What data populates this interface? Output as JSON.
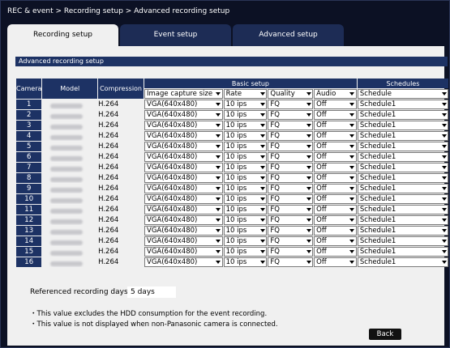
{
  "breadcrumb": "REC & event > Recording setup > Advanced recording setup",
  "tabs": [
    {
      "label": "Recording setup",
      "active": true
    },
    {
      "label": "Event setup",
      "active": false
    },
    {
      "label": "Advanced setup",
      "active": false
    }
  ],
  "section_title": "Advanced recording setup",
  "headers": {
    "camera": "Camera",
    "model": "Model",
    "compression": "Compression",
    "basic_setup": "Basic setup",
    "schedules": "Schedules",
    "image_capture_size": "Image capture size",
    "rate": "Rate",
    "quality": "Quality",
    "audio": "Audio",
    "schedule": "Schedule"
  },
  "rows": [
    {
      "camera": "1",
      "compression": "H.264",
      "size": "VGA(640x480)",
      "rate": "10 ips",
      "quality": "FQ",
      "audio": "Off",
      "schedule": "Schedule1"
    },
    {
      "camera": "2",
      "compression": "H.264",
      "size": "VGA(640x480)",
      "rate": "10 ips",
      "quality": "FQ",
      "audio": "Off",
      "schedule": "Schedule1"
    },
    {
      "camera": "3",
      "compression": "H.264",
      "size": "VGA(640x480)",
      "rate": "10 ips",
      "quality": "FQ",
      "audio": "Off",
      "schedule": "Schedule1"
    },
    {
      "camera": "4",
      "compression": "H.264",
      "size": "VGA(640x480)",
      "rate": "10 ips",
      "quality": "FQ",
      "audio": "Off",
      "schedule": "Schedule1"
    },
    {
      "camera": "5",
      "compression": "H.264",
      "size": "VGA(640x480)",
      "rate": "10 ips",
      "quality": "FQ",
      "audio": "Off",
      "schedule": "Schedule1"
    },
    {
      "camera": "6",
      "compression": "H.264",
      "size": "VGA(640x480)",
      "rate": "10 ips",
      "quality": "FQ",
      "audio": "Off",
      "schedule": "Schedule1"
    },
    {
      "camera": "7",
      "compression": "H.264",
      "size": "VGA(640x480)",
      "rate": "10 ips",
      "quality": "FQ",
      "audio": "Off",
      "schedule": "Schedule1"
    },
    {
      "camera": "8",
      "compression": "H.264",
      "size": "VGA(640x480)",
      "rate": "10 ips",
      "quality": "FQ",
      "audio": "Off",
      "schedule": "Schedule1"
    },
    {
      "camera": "9",
      "compression": "H.264",
      "size": "VGA(640x480)",
      "rate": "10 ips",
      "quality": "FQ",
      "audio": "Off",
      "schedule": "Schedule1"
    },
    {
      "camera": "10",
      "compression": "H.264",
      "size": "VGA(640x480)",
      "rate": "10 ips",
      "quality": "FQ",
      "audio": "Off",
      "schedule": "Schedule1"
    },
    {
      "camera": "11",
      "compression": "H.264",
      "size": "VGA(640x480)",
      "rate": "10 ips",
      "quality": "FQ",
      "audio": "Off",
      "schedule": "Schedule1"
    },
    {
      "camera": "12",
      "compression": "H.264",
      "size": "VGA(640x480)",
      "rate": "10 ips",
      "quality": "FQ",
      "audio": "Off",
      "schedule": "Schedule1"
    },
    {
      "camera": "13",
      "compression": "H.264",
      "size": "VGA(640x480)",
      "rate": "10 ips",
      "quality": "FQ",
      "audio": "Off",
      "schedule": "Schedule1"
    },
    {
      "camera": "14",
      "compression": "H.264",
      "size": "VGA(640x480)",
      "rate": "10 ips",
      "quality": "FQ",
      "audio": "Off",
      "schedule": "Schedule1"
    },
    {
      "camera": "15",
      "compression": "H.264",
      "size": "VGA(640x480)",
      "rate": "10 ips",
      "quality": "FQ",
      "audio": "Off",
      "schedule": "Schedule1"
    },
    {
      "camera": "16",
      "compression": "H.264",
      "size": "VGA(640x480)",
      "rate": "10 ips",
      "quality": "FQ",
      "audio": "Off",
      "schedule": "Schedule1"
    }
  ],
  "referenced_days": {
    "label": "Referenced recording days",
    "value": "5 days"
  },
  "notes": [
    "・This value excludes the HDD consumption for the event recording.",
    "・This value is not displayed when non-Panasonic camera is connected."
  ],
  "back_label": "Back",
  "icons": {
    "dropdown": "chevron-down-icon"
  },
  "colors": {
    "background": "#0c1124",
    "header": "#1d3264",
    "panel": "#f0f0f0",
    "tab_inactive": "#1d2c55"
  }
}
